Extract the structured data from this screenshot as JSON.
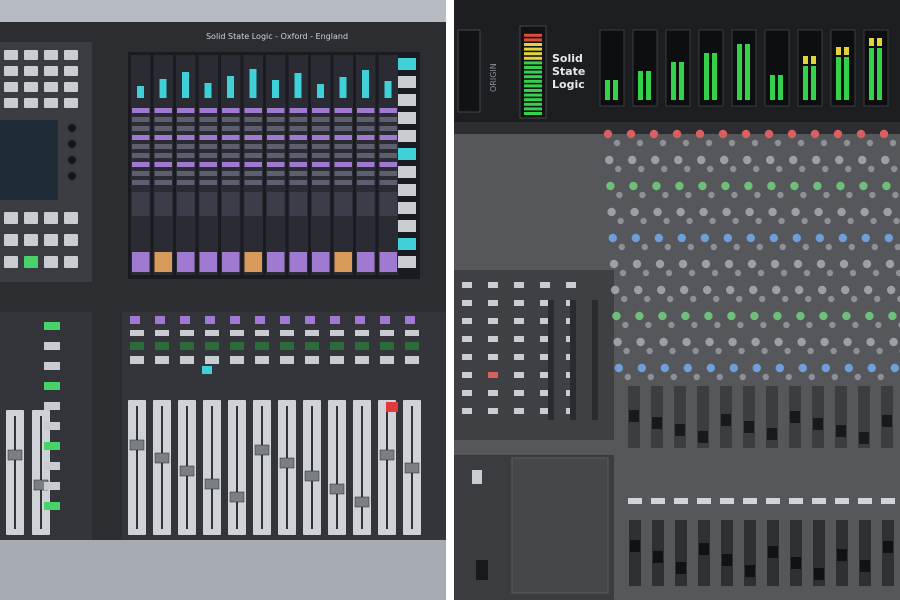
{
  "left_console": {
    "brand_line": "Solid State Logic  -  Oxford  -  England",
    "colors": {
      "frame": "#9aa0a6",
      "body": "#2b2d31",
      "screen_bg": "#1a1b20",
      "meter_cyan": "#3fd0d8",
      "strip_purple": "#a07ad0",
      "strip_orange": "#d89a5a",
      "button_green": "#49d16a",
      "button_red": "#e03a3a",
      "fader_lane": "#cfd3d8"
    }
  },
  "right_console": {
    "logo_line1": "Solid",
    "logo_line2": "State",
    "logo_line3": "Logic",
    "model_text": "ORIGIN",
    "colors": {
      "body": "#4a4c50",
      "top_panel": "#1d1e21",
      "meter_green": "#34d14a",
      "meter_yellow": "#e3d23a",
      "meter_red": "#e24a3a",
      "knob_red": "#d86060",
      "knob_green": "#6fbf7a",
      "knob_blue": "#6f9fd8",
      "knob_grey": "#9aa0a6"
    }
  }
}
